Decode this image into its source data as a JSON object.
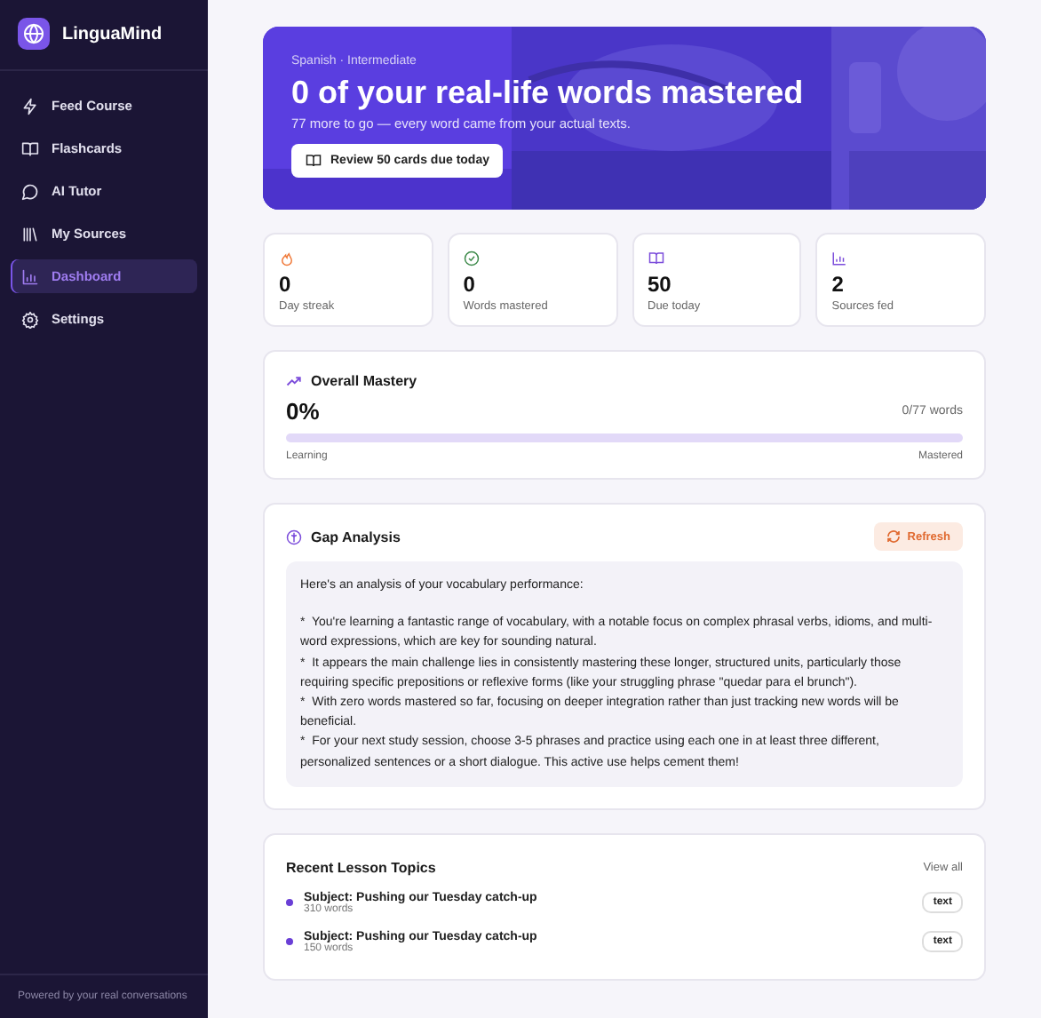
{
  "sidebar": {
    "brand": "LinguaMind",
    "items": [
      {
        "label": "Feed Course",
        "selected": false
      },
      {
        "label": "Flashcards",
        "selected": false
      },
      {
        "label": "AI Tutor",
        "selected": false
      },
      {
        "label": "My Sources",
        "selected": false
      },
      {
        "label": "Dashboard",
        "selected": true
      },
      {
        "label": "Settings",
        "selected": false
      }
    ],
    "footer": "Powered by your real conversations"
  },
  "hero": {
    "eyebrow": "Spanish · Intermediate",
    "title": "0 of your real-life words mastered",
    "subtitle": "77 more to go — every word came from your actual texts.",
    "button": "Review 50 cards due today"
  },
  "stats": [
    {
      "value": "0",
      "label": "Day streak"
    },
    {
      "value": "0",
      "label": "Words mastered"
    },
    {
      "value": "50",
      "label": "Due today"
    },
    {
      "value": "2",
      "label": "Sources fed"
    }
  ],
  "mastery": {
    "title": "Overall Mastery",
    "percent": "0%",
    "count": "0/77 words",
    "level": 0,
    "left_label": "Learning",
    "right_label": "Mastered"
  },
  "gap_analysis": {
    "title": "Gap Analysis",
    "button": "Refresh",
    "intro": "Here's an analysis of your vocabulary performance:",
    "bullets": [
      {
        "text": "*  You're learning a fantastic range of vocabulary, with a notable focus on complex phrasal verbs, idioms, and multi-word expressions, which are key for sounding natural."
      },
      {
        "text": "*  It appears the main challenge lies in consistently mastering these longer, structured units, particularly those requiring specific prepositions or reflexive forms (like your struggling phrase \"quedar para el brunch\")."
      },
      {
        "text": "*  With zero words mastered so far, focusing on deeper integration rather than just tracking new words will be beneficial."
      },
      {
        "text": "*  For your next study session, choose 3-5 phrases and practice using each one in at least three different, personalized sentences or a short dialogue. This active use helps cement them!"
      }
    ]
  },
  "recent": {
    "title": "Recent Lesson Topics",
    "link": "View all",
    "items": [
      {
        "title": "Subject: Pushing our Tuesday catch-up",
        "meta": "310 words",
        "tag": "text"
      },
      {
        "title": "Subject: Pushing our Tuesday catch-up",
        "meta": "150 words",
        "tag": "text"
      }
    ]
  }
}
